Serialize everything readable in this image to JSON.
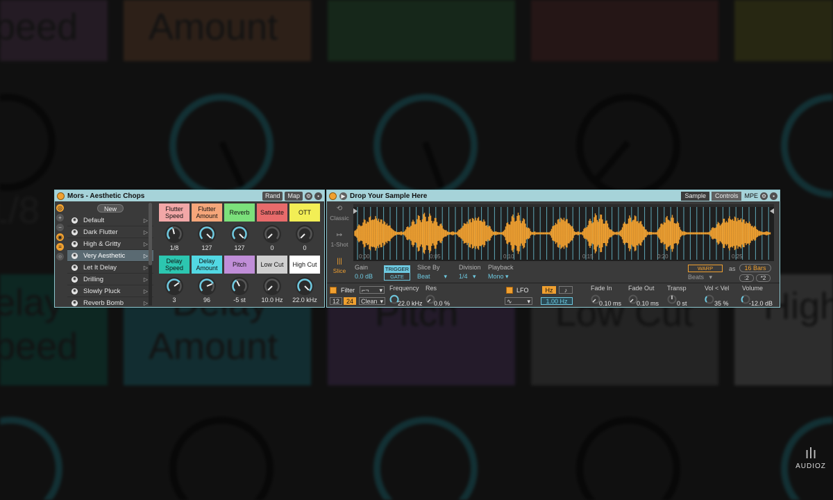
{
  "background": {
    "labels": [
      "peed",
      "Amount",
      "1/8",
      "elay",
      "peed",
      "Delay",
      "Amount",
      "Pitch",
      "Low Cut",
      "High"
    ]
  },
  "left_device": {
    "title": "Mors - Aesthetic Chops",
    "rand_label": "Rand",
    "map_label": "Map",
    "new_label": "New",
    "presets": [
      "Default",
      "Dark Flutter",
      "High & Gritty",
      "Very Aesthetic",
      "Let It Delay",
      "Drilling",
      "Slowly Pluck",
      "Reverb Bomb"
    ],
    "selected_preset": "Very Aesthetic",
    "macros": [
      {
        "label": "Flutter Speed",
        "value": "1/8",
        "color": "#f2a7a7",
        "level": 0.45
      },
      {
        "label": "Flutter Amount",
        "value": "127",
        "color": "#f5a67a",
        "level": 1.0
      },
      {
        "label": "Reverb",
        "value": "127",
        "color": "#7be07b",
        "level": 1.0
      },
      {
        "label": "Saturate",
        "value": "0",
        "color": "#e86b6b",
        "level": 0.0
      },
      {
        "label": "OTT",
        "value": "0",
        "color": "#f2ee55",
        "level": 0.0
      },
      {
        "label": "Delay Speed",
        "value": "3",
        "color": "#2cc6b0",
        "level": 0.7
      },
      {
        "label": "Delay Amount",
        "value": "96",
        "color": "#52d8e3",
        "level": 0.75
      },
      {
        "label": "Pitch",
        "value": "-5 st",
        "color": "#c08ed8",
        "level": 0.4
      },
      {
        "label": "Low Cut",
        "value": "10.0 Hz",
        "color": "#d0d0d0",
        "level": 0.0
      },
      {
        "label": "High Cut",
        "value": "22.0 kHz",
        "color": "#ffffff",
        "level": 1.0
      }
    ]
  },
  "right_device": {
    "title": "Drop Your Sample Here",
    "tab_sample": "Sample",
    "tab_controls": "Controls",
    "mpe_label": "MPE",
    "modes": [
      {
        "label": "Classic",
        "icon": "⟲"
      },
      {
        "label": "1-Shot",
        "icon": "↦"
      },
      {
        "label": "Slice",
        "icon": "|||"
      }
    ],
    "timeline": [
      "0:00",
      "0:05",
      "0:10",
      "0:15",
      "0:20",
      "0:25"
    ],
    "gain_label": "Gain",
    "gain_value": "0.0 dB",
    "trigger_label": "TRIGGER",
    "gate_label": "GATE",
    "slice_by_label": "Slice By",
    "slice_by_value": "Beat",
    "division_label": "Division",
    "division_value": "1/4",
    "playback_label": "Playback",
    "playback_value": "Mono",
    "warp_label": "WARP",
    "as_label": "as",
    "bars_value": "16 Bars",
    "beats_value": "Beats",
    "half_label": ":2",
    "double_label": "*2",
    "filter_label": "Filter",
    "filter_slope_12": "12",
    "filter_slope_24": "24",
    "filter_circuit": "Clean",
    "frequency_label": "Frequency",
    "frequency_value": "22.0 kHz",
    "res_label": "Res",
    "res_value": "0.0 %",
    "lfo_label": "LFO",
    "lfo_hz_label": "Hz",
    "lfo_note_label": "♪",
    "lfo_rate": "1.00 Hz",
    "fade_in_label": "Fade In",
    "fade_in_value": "0.10 ms",
    "fade_out_label": "Fade Out",
    "fade_out_value": "0.10 ms",
    "transp_label": "Transp",
    "transp_value": "0 st",
    "vol_vel_label": "Vol < Vel",
    "vol_vel_value": "35 %",
    "volume_label": "Volume",
    "volume_value": "-12.0 dB"
  },
  "watermark": "AUDIOZ",
  "colors": {
    "accent_orange": "#f0a030",
    "accent_blue": "#6ec9e0",
    "title_bar": "#a6d3d9",
    "panel": "#3a3a3a"
  }
}
